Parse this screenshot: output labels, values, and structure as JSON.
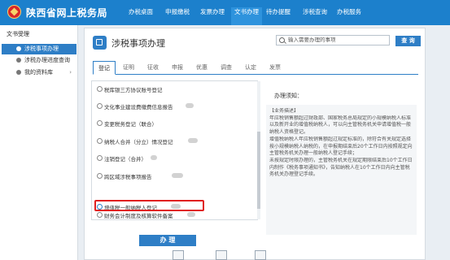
{
  "header": {
    "site_title": "陕西省网上税务局",
    "nav": [
      {
        "label": "办税桌面",
        "active": false
      },
      {
        "label": "申报缴税",
        "active": false
      },
      {
        "label": "发票办理",
        "active": false
      },
      {
        "label": "文书办理",
        "active": true
      },
      {
        "label": "待办提醒",
        "active": false
      },
      {
        "label": "涉税查询",
        "active": false
      },
      {
        "label": "办税服务",
        "active": false
      }
    ]
  },
  "sidebar": {
    "title": "文书受理",
    "items": [
      {
        "label": "涉税事项办理",
        "active": true
      },
      {
        "label": "涉税办理进度查询",
        "active": false
      },
      {
        "label": "我的资料库",
        "active": false
      }
    ]
  },
  "panel": {
    "title": "涉税事项办理",
    "search_placeholder": "输入需要办理的事项",
    "search_button": "查 询",
    "tabs": [
      "登记",
      "证明",
      "征收",
      "申报",
      "优惠",
      "调查",
      "认定",
      "发票"
    ],
    "active_tab": "登记",
    "list": [
      {
        "label": "税库银三方协议账号登记",
        "selected": false
      },
      {
        "label": "文化事业建设费缴费信息报告",
        "selected": false
      },
      {
        "label": "变更税务登记（联合）",
        "selected": false
      },
      {
        "label": "纳税人合并（分立）情况登记",
        "selected": false
      },
      {
        "label": "注销登记（合并）",
        "selected": false
      },
      {
        "label": "跨区域涉税事项报告",
        "selected": false
      },
      {
        "label": "增值税一般纳税人登记",
        "selected": true
      },
      {
        "label": "财务会计制度及核算软件备案",
        "selected": false
      }
    ],
    "action_button": "办 理",
    "notice": {
      "title": "办理须知：",
      "lines": [
        "【业务描述】",
        "年应税销售额超过财政部、国家税务总局规定的小规模纳税人标准以及新开业的增值税纳税人，可以向主管税务机关申请增值税一般纳税人资格登记。",
        "增值税纳税人年应税销售额超过规定标准的，除符合有关规定选择按小规模纳税人纳税的，在申报期结束后20个工作日内按照规定向主管税务机关办理一般纳税人登记手续；",
        "未按规定时限办理的，主管税务机关在规定期限结束后10个工作日内制作《税务事项通知书》，告知纳税人在10个工作日内向主管税务机关办理登记手续。"
      ]
    }
  }
}
